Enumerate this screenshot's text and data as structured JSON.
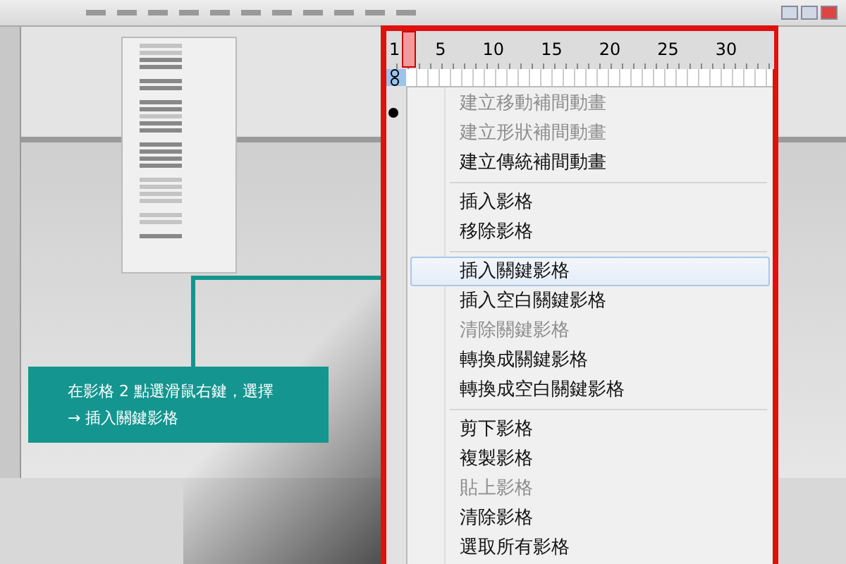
{
  "ruler": {
    "labels": [
      "1",
      "5",
      "10",
      "15",
      "20",
      "25",
      "30"
    ]
  },
  "context_menu": {
    "groups": [
      [
        {
          "label": "建立移動補間動畫",
          "disabled": true,
          "selected": false
        },
        {
          "label": "建立形狀補間動畫",
          "disabled": true,
          "selected": false
        },
        {
          "label": "建立傳統補間動畫",
          "disabled": false,
          "selected": false
        }
      ],
      [
        {
          "label": "插入影格",
          "disabled": false,
          "selected": false
        },
        {
          "label": "移除影格",
          "disabled": false,
          "selected": false
        }
      ],
      [
        {
          "label": "插入關鍵影格",
          "disabled": false,
          "selected": true
        },
        {
          "label": "插入空白關鍵影格",
          "disabled": false,
          "selected": false
        },
        {
          "label": "清除關鍵影格",
          "disabled": true,
          "selected": false
        },
        {
          "label": "轉換成關鍵影格",
          "disabled": false,
          "selected": false
        },
        {
          "label": "轉換成空白關鍵影格",
          "disabled": false,
          "selected": false
        }
      ],
      [
        {
          "label": "剪下影格",
          "disabled": false,
          "selected": false
        },
        {
          "label": "複製影格",
          "disabled": false,
          "selected": false
        },
        {
          "label": "貼上影格",
          "disabled": true,
          "selected": false
        },
        {
          "label": "清除影格",
          "disabled": false,
          "selected": false
        },
        {
          "label": "選取所有影格",
          "disabled": false,
          "selected": false
        }
      ]
    ]
  },
  "callout": {
    "lines": [
      "在影格 2 點選滑鼠右鍵，選擇",
      "→ 插入關鍵影格"
    ]
  }
}
